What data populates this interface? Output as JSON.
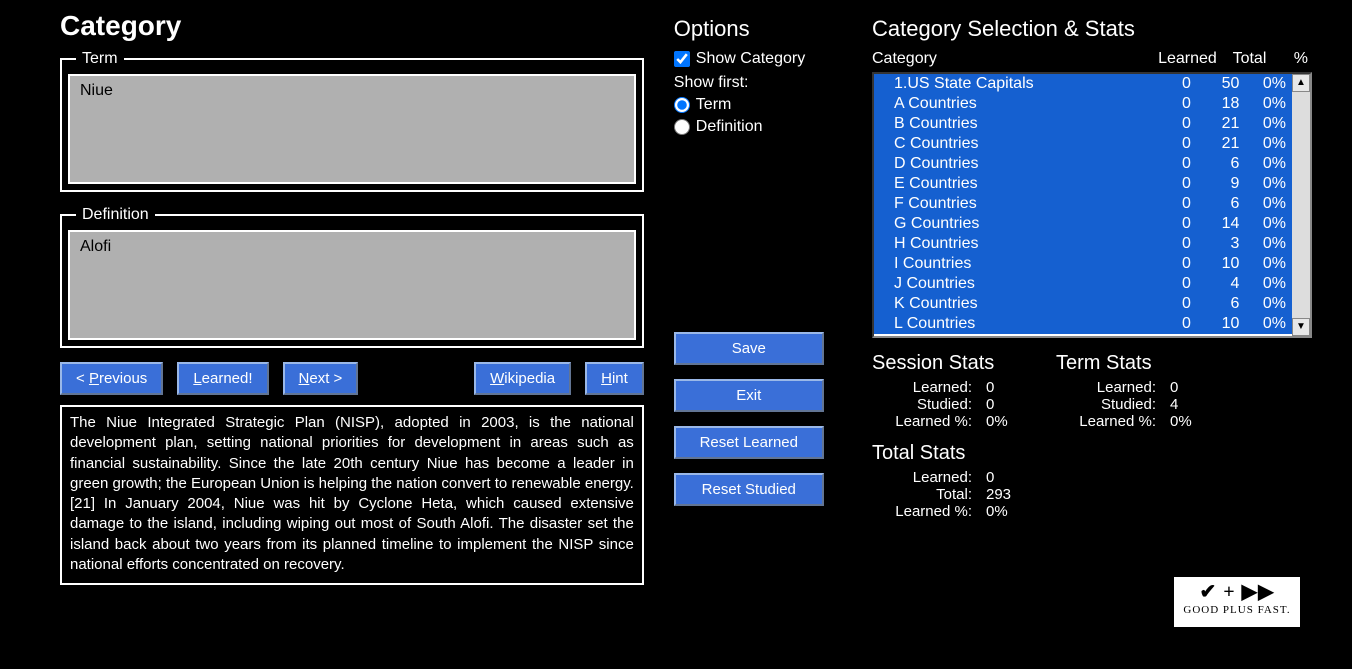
{
  "page_title": "Category",
  "term_legend": "Term",
  "term_value": "Niue",
  "def_legend": "Definition",
  "def_value": "Alofi",
  "buttons": {
    "previous": "< Previous",
    "learned": "Learned!",
    "next": "Next >",
    "wikipedia": "Wikipedia",
    "hint": "Hint",
    "save": "Save",
    "exit": "Exit",
    "reset_learned": "Reset Learned",
    "reset_studied": "Reset Studied"
  },
  "description": "The Niue Integrated Strategic Plan (NISP), adopted in 2003, is the national development plan, setting national priorities for development in areas such as financial sustainability. Since the late 20th century Niue has become a leader in green growth; the European Union is helping the nation convert to renewable energy.[21] In January 2004, Niue was hit by Cyclone Heta, which caused extensive damage to the island, including wiping out most of South Alofi. The disaster set the island back about two years from its planned timeline to implement the NISP since national efforts concentrated on recovery.",
  "options": {
    "heading": "Options",
    "show_category_label": "Show Category",
    "show_category_checked": true,
    "show_first_label": "Show first:",
    "radio_term": "Term",
    "radio_def": "Definition",
    "radio_selected": "term"
  },
  "cat_section": {
    "heading": "Category Selection & Stats",
    "col_category": "Category",
    "col_learned": "Learned",
    "col_total": "Total",
    "col_pct": "%",
    "rows": [
      {
        "name": "1.US State Capitals",
        "learned": 0,
        "total": 50,
        "pct": "0%"
      },
      {
        "name": "A Countries",
        "learned": 0,
        "total": 18,
        "pct": "0%"
      },
      {
        "name": "B Countries",
        "learned": 0,
        "total": 21,
        "pct": "0%"
      },
      {
        "name": "C Countries",
        "learned": 0,
        "total": 21,
        "pct": "0%"
      },
      {
        "name": "D Countries",
        "learned": 0,
        "total": 6,
        "pct": "0%"
      },
      {
        "name": "E Countries",
        "learned": 0,
        "total": 9,
        "pct": "0%"
      },
      {
        "name": "F Countries",
        "learned": 0,
        "total": 6,
        "pct": "0%"
      },
      {
        "name": "G Countries",
        "learned": 0,
        "total": 14,
        "pct": "0%"
      },
      {
        "name": "H Countries",
        "learned": 0,
        "total": 3,
        "pct": "0%"
      },
      {
        "name": "I Countries",
        "learned": 0,
        "total": 10,
        "pct": "0%"
      },
      {
        "name": "J Countries",
        "learned": 0,
        "total": 4,
        "pct": "0%"
      },
      {
        "name": "K Countries",
        "learned": 0,
        "total": 6,
        "pct": "0%"
      },
      {
        "name": "L Countries",
        "learned": 0,
        "total": 10,
        "pct": "0%"
      }
    ]
  },
  "session_stats": {
    "heading": "Session Stats",
    "learned_lbl": "Learned:",
    "learned_val": "0",
    "studied_lbl": "Studied:",
    "studied_val": "0",
    "pct_lbl": "Learned %:",
    "pct_val": "0%"
  },
  "term_stats": {
    "heading": "Term Stats",
    "learned_lbl": "Learned:",
    "learned_val": "0",
    "studied_lbl": "Studied:",
    "studied_val": "4",
    "pct_lbl": "Learned %:",
    "pct_val": "0%"
  },
  "total_stats": {
    "heading": "Total Stats",
    "learned_lbl": "Learned:",
    "learned_val": "0",
    "total_lbl": "Total:",
    "total_val": "293",
    "pct_lbl": "Learned %:",
    "pct_val": "0%"
  },
  "logo": {
    "glyphs": "✔ + ▶▶",
    "text": "GOOD PLUS FAST."
  }
}
